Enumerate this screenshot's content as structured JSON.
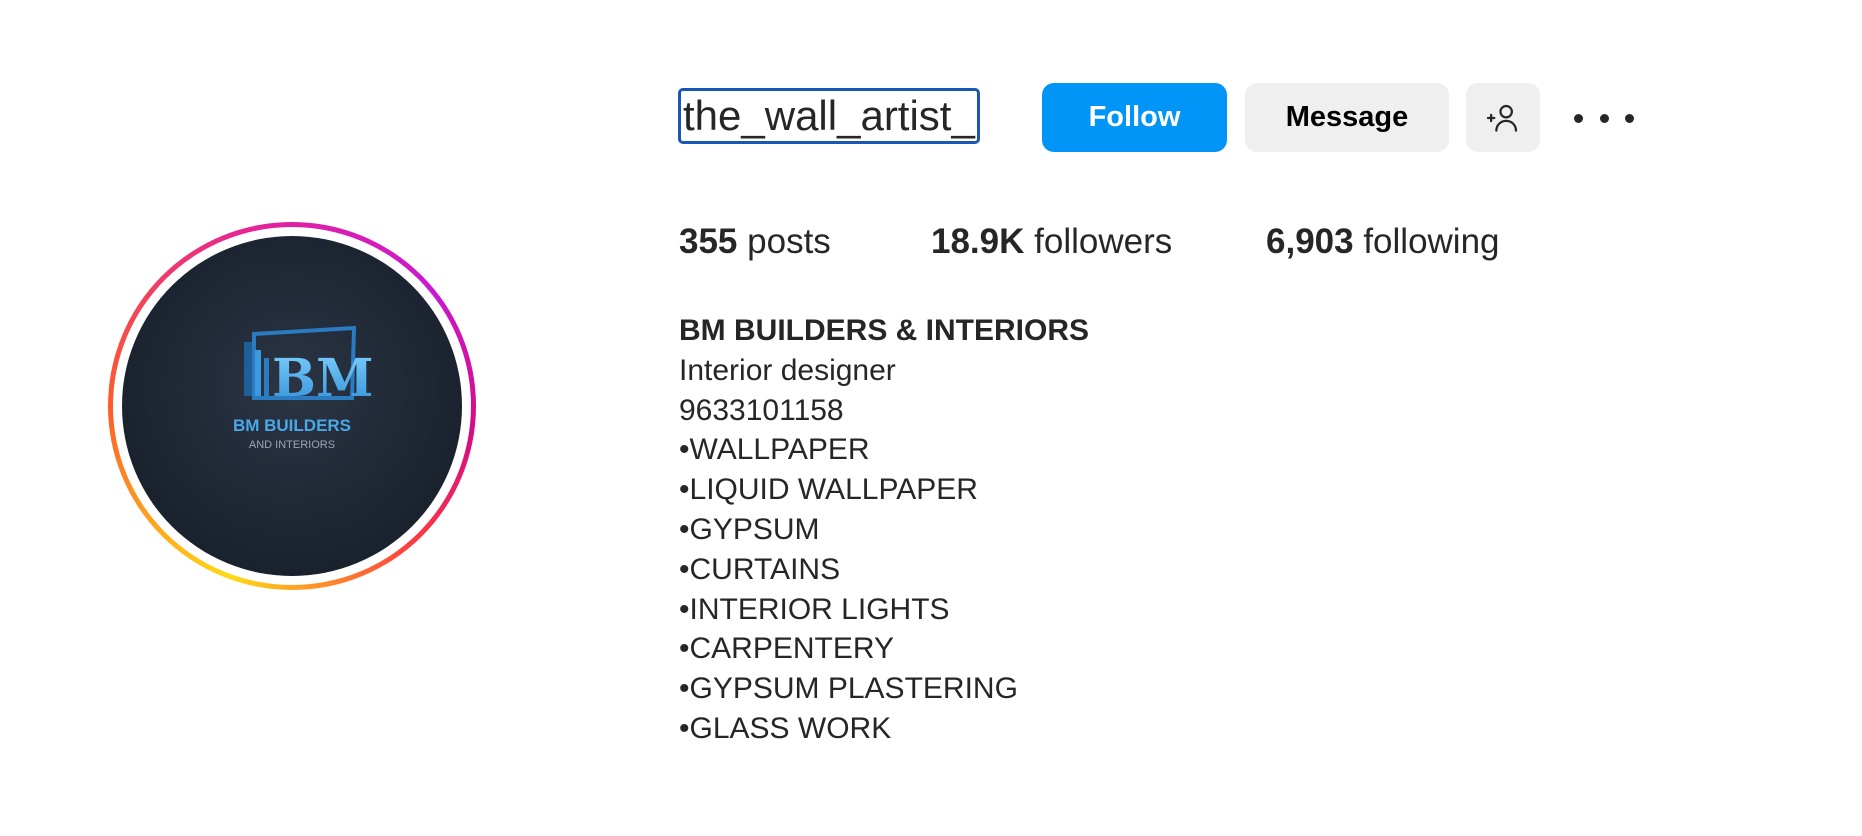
{
  "profile": {
    "username": "the_wall_artist_",
    "avatar_logo": {
      "monogram": "BM",
      "line1": "BM BUILDERS",
      "line2": "AND INTERIORS"
    },
    "colors": {
      "follow_bg": "#0095f6",
      "secondary_bg": "#efefef",
      "text": "#262626"
    }
  },
  "actions": {
    "follow_label": "Follow",
    "message_label": "Message",
    "add_user_icon": "person-add-icon",
    "more_icon": "more-horizontal-icon"
  },
  "stats": {
    "posts_count": "355",
    "posts_label": "posts",
    "followers_count": "18.9K",
    "followers_label": "followers",
    "following_count": "6,903",
    "following_label": "following"
  },
  "bio": {
    "name": "BM BUILDERS & INTERIORS",
    "category": "Interior designer",
    "phone": "9633101158",
    "lines": [
      "•WALLPAPER",
      "•LIQUID WALLPAPER",
      "•GYPSUM",
      "•CURTAINS",
      "•INTERIOR LIGHTS",
      "•CARPENTERY",
      "•GYPSUM PLASTERING",
      "•GLASS WORK"
    ]
  }
}
